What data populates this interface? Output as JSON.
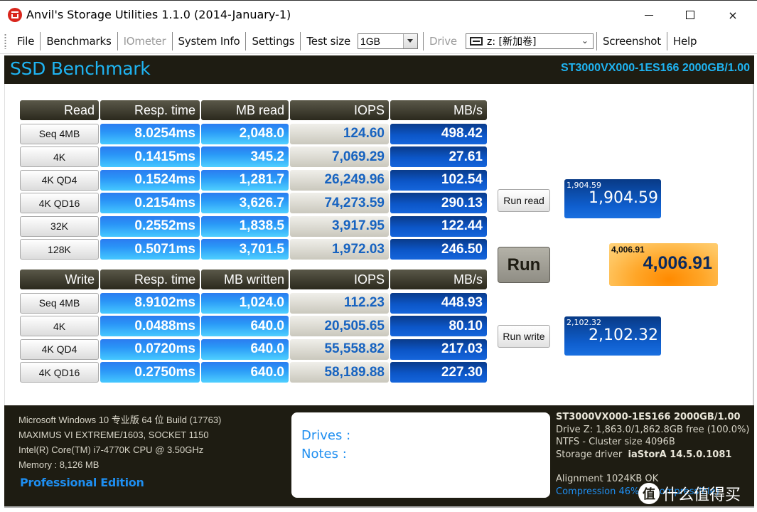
{
  "window": {
    "title": "Anvil's Storage Utilities 1.1.0 (2014-January-1)",
    "app_icon": "anvil-app-icon",
    "controls": {
      "minimize": "minimize-icon",
      "maximize": "maximize-icon",
      "close": "×"
    }
  },
  "menu": {
    "items": [
      {
        "label": "File",
        "enabled": true
      },
      {
        "label": "Benchmarks",
        "enabled": true
      },
      {
        "label": "IOmeter",
        "enabled": false
      },
      {
        "label": "System Info",
        "enabled": true
      },
      {
        "label": "Settings",
        "enabled": true
      }
    ],
    "test_size_label": "Test size",
    "test_size_value": "1GB",
    "drive_label": "Drive",
    "drive_value": "z: [新加卷]",
    "screenshot_label": "Screenshot",
    "help_label": "Help"
  },
  "header": {
    "title": "SSD Benchmark",
    "drive_model": "ST3000VX000-1ES166 2000GB/1.00"
  },
  "read_table": {
    "headers": [
      "Read",
      "Resp. time",
      "MB read",
      "IOPS",
      "MB/s"
    ],
    "rows": [
      {
        "test": "Seq 4MB",
        "resp": "8.0254ms",
        "mb": "2,048.0",
        "iops": "124.60",
        "mbs": "498.42"
      },
      {
        "test": "4K",
        "resp": "0.1415ms",
        "mb": "345.2",
        "iops": "7,069.29",
        "mbs": "27.61"
      },
      {
        "test": "4K QD4",
        "resp": "0.1524ms",
        "mb": "1,281.7",
        "iops": "26,249.96",
        "mbs": "102.54"
      },
      {
        "test": "4K QD16",
        "resp": "0.2154ms",
        "mb": "3,626.7",
        "iops": "74,273.59",
        "mbs": "290.13"
      },
      {
        "test": "32K",
        "resp": "0.2552ms",
        "mb": "1,838.5",
        "iops": "3,917.95",
        "mbs": "122.44"
      },
      {
        "test": "128K",
        "resp": "0.5071ms",
        "mb": "3,701.5",
        "iops": "1,972.03",
        "mbs": "246.50"
      }
    ]
  },
  "write_table": {
    "headers": [
      "Write",
      "Resp. time",
      "MB written",
      "IOPS",
      "MB/s"
    ],
    "rows": [
      {
        "test": "Seq 4MB",
        "resp": "8.9102ms",
        "mb": "1,024.0",
        "iops": "112.23",
        "mbs": "448.93"
      },
      {
        "test": "4K",
        "resp": "0.0488ms",
        "mb": "640.0",
        "iops": "20,505.65",
        "mbs": "80.10"
      },
      {
        "test": "4K QD4",
        "resp": "0.0720ms",
        "mb": "640.0",
        "iops": "55,558.82",
        "mbs": "217.03"
      },
      {
        "test": "4K QD16",
        "resp": "0.2750ms",
        "mb": "640.0",
        "iops": "58,189.88",
        "mbs": "227.30"
      }
    ]
  },
  "actions": {
    "run_read": "Run read",
    "run": "Run",
    "run_write": "Run write"
  },
  "scores": {
    "read": {
      "small": "1,904.59",
      "big": "1,904.59"
    },
    "total": {
      "small": "4,006.91",
      "big": "4,006.91"
    },
    "write": {
      "small": "2,102.32",
      "big": "2,102.32"
    }
  },
  "system_info": {
    "lines": [
      "Microsoft Windows 10 专业版 64 位 Build (17763)",
      "MAXIMUS VI EXTREME/1603, SOCKET 1150",
      "Intel(R) Core(TM) i7-4770K CPU @ 3.50GHz",
      "Memory : 8,126 MB"
    ],
    "edition": "Professional Edition"
  },
  "notes": {
    "drives_label": "Drives :",
    "notes_label": "Notes :"
  },
  "drive_info": {
    "model": "ST3000VX000-1ES166 2000GB/1.00",
    "free": "Drive Z: 1,863.0/1,862.8GB free (100.0%)",
    "fs": "NTFS - Cluster size 4096B",
    "driver_label": "Storage driver",
    "driver_value": "iaStorA 14.5.0.1081",
    "alignment": "Alignment 1024KB OK",
    "compression": "Compression 46% (Incompressible)"
  },
  "watermark": {
    "badge": "值",
    "text": "什么值得买"
  }
}
